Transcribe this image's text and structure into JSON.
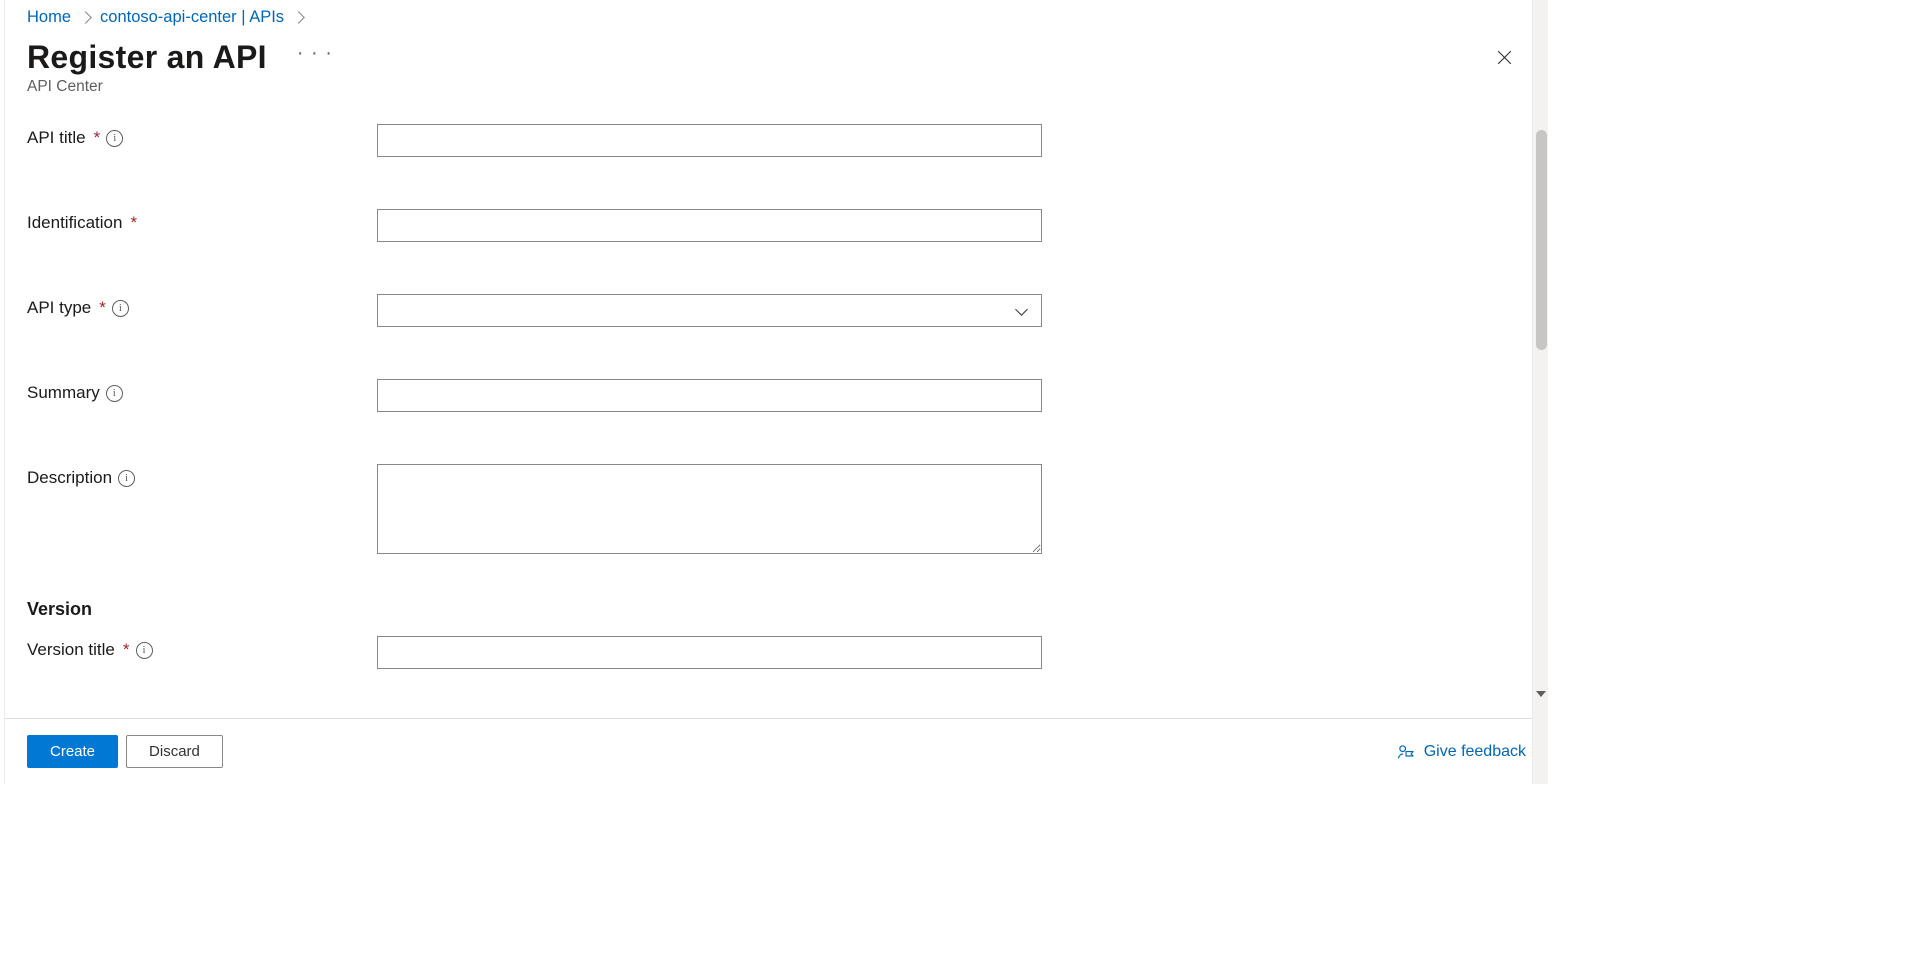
{
  "breadcrumb": {
    "home": "Home",
    "center": "contoso-api-center | APIs"
  },
  "page": {
    "title": "Register an API",
    "subtitle": "API Center",
    "more_aria": "More"
  },
  "form": {
    "api_title_label": "API title",
    "api_title_value": "",
    "identification_label": "Identification",
    "identification_value": "",
    "api_type_label": "API type",
    "api_type_value": "",
    "summary_label": "Summary",
    "summary_value": "",
    "description_label": "Description",
    "description_value": ""
  },
  "version": {
    "section_heading": "Version",
    "title_label": "Version title",
    "title_value": ""
  },
  "footer": {
    "create": "Create",
    "discard": "Discard",
    "feedback": "Give feedback"
  }
}
